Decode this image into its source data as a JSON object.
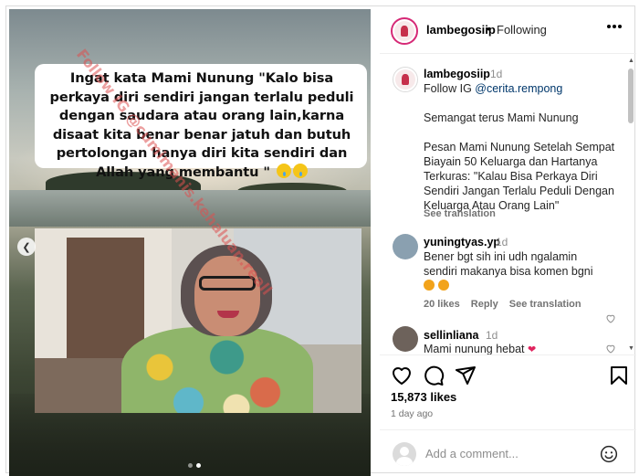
{
  "post": {
    "caption_overlay": "Ingat kata Mami Nunung \"Kalo bisa perkaya diri sendiri jangan terlalu peduli dengan saudara atau orang lain,karna disaat kita benar benar jatuh dan butuh pertolongan hanya diri kita sendiri dan Allah yang membantu \"",
    "watermark": "Follow IG @cumimanis.kehaluan.reall",
    "carousel": {
      "current": 2,
      "total": 2
    }
  },
  "header": {
    "username": "lambegosiip",
    "separator": "•",
    "follow_state": "Following"
  },
  "caption": {
    "username": "lambegosiip",
    "time": "1d",
    "line1_prefix": "Follow IG ",
    "line1_link": "@cerita.rempong",
    "para2": "Semangat terus Mami Nunung",
    "para3": "Pesan Mami Nunung Setelah Sempat Biayain 50 Keluarga dan Hartanya Terkuras: \"Kalau Bisa Perkaya Diri Sendiri Jangan Terlalu Peduli Dengan Keluarga Atau Orang Lain\"",
    "see_translation": "See translation"
  },
  "comments": [
    {
      "username": "yuningtyas.yp",
      "time": "1d",
      "text": "Bener bgt sih ini udh ngalamin sendiri makanya bisa komen bgni",
      "likes": "20 likes",
      "reply": "Reply",
      "see_translation": "See translation"
    },
    {
      "username": "sellinliana",
      "time": "1d",
      "text": "Mami nunung hebat"
    }
  ],
  "stats": {
    "likes": "15,873 likes",
    "time_ago": "1 day ago"
  },
  "add_comment": {
    "placeholder": "Add a comment..."
  },
  "icons": {
    "like": "heart-icon",
    "comment": "comment-icon",
    "share": "share-icon",
    "save": "bookmark-icon",
    "more": "more-icon",
    "emoji": "emoji-icon"
  },
  "colors": {
    "story_ring": "#d62976",
    "link": "#00376b",
    "muted": "#737373"
  }
}
